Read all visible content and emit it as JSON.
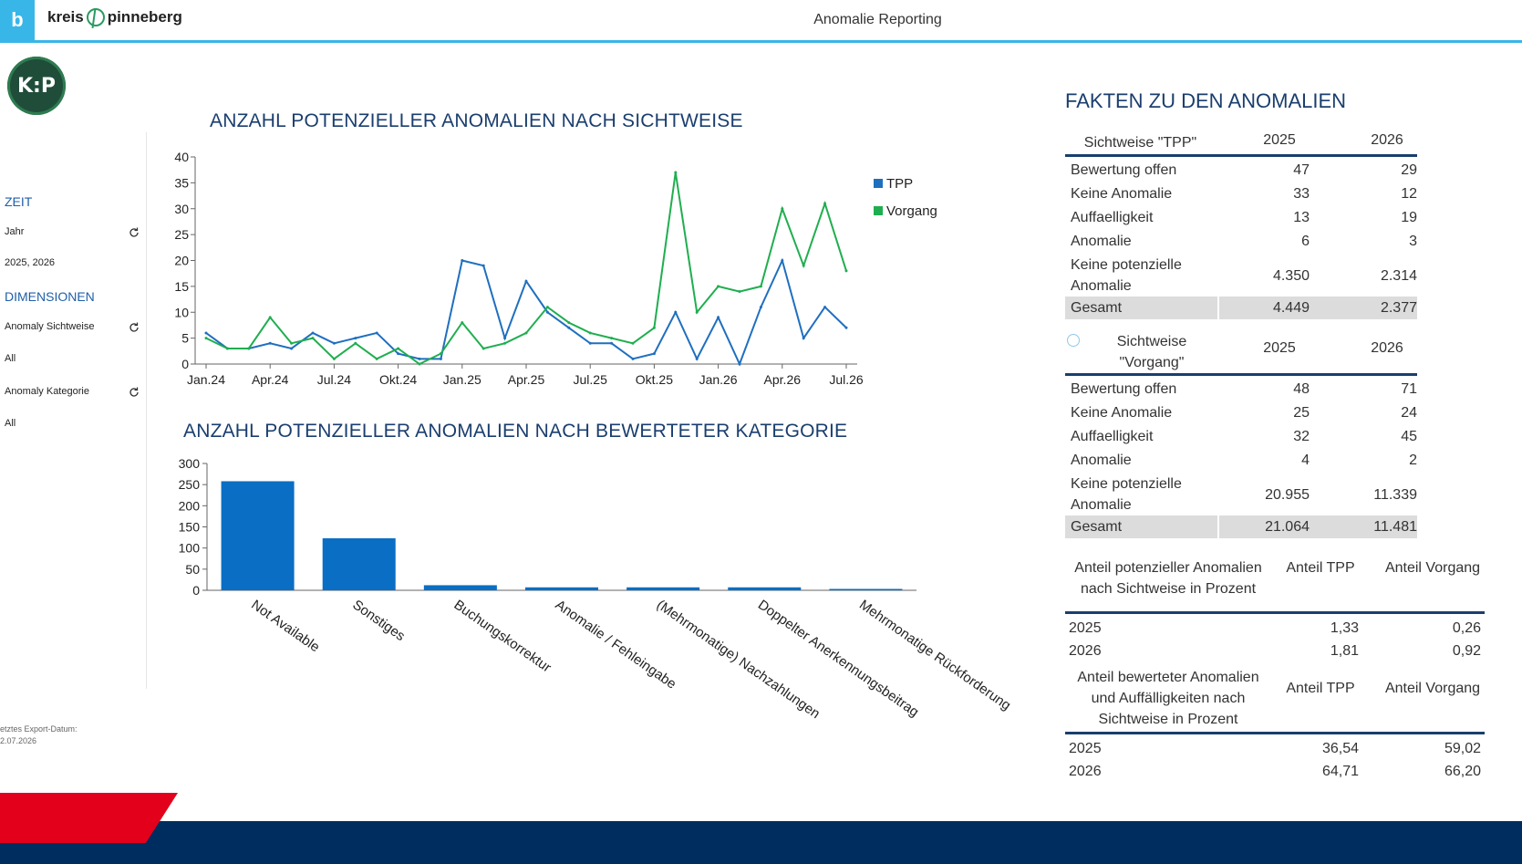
{
  "header": {
    "app_badge": "b",
    "brand_left": "kreis",
    "brand_right": "pinneberg",
    "title": "Anomalie Reporting"
  },
  "logo": {
    "text": "K:P"
  },
  "sidebar": {
    "zeit": "ZEIT",
    "jahr_label": "Jahr",
    "jahr_value": "2025, 2026",
    "dimensionen": "DIMENSIONEN",
    "sichtweise_label": "Anomaly Sichtweise",
    "sichtweise_value": "All",
    "kategorie_label": "Anomaly Kategorie",
    "kategorie_value": "All",
    "export_label": "etztes Export-Datum:",
    "export_value": "2.07.2026"
  },
  "line_chart": {
    "title": "ANZAHL POTENZIELLER ANOMALIEN NACH SICHTWEISE"
  },
  "bar_chart": {
    "title": "ANZAHL POTENZIELLER ANOMALIEN NACH BEWERTETER KATEGORIE"
  },
  "chart_data": [
    {
      "type": "line",
      "x": [
        "Jan.24",
        "Feb.24",
        "Mär.24",
        "Apr.24",
        "Mai.24",
        "Jun.24",
        "Jul.24",
        "Aug.24",
        "Sep.24",
        "Okt.24",
        "Nov.24",
        "Dez.24",
        "Jan.25",
        "Feb.25",
        "Mär.25",
        "Apr.25",
        "Mai.25",
        "Jun.25",
        "Jul.25",
        "Aug.25",
        "Sep.25",
        "Okt.25",
        "Nov.25",
        "Dez.25",
        "Jan.26",
        "Feb.26",
        "Mär.26",
        "Apr.26",
        "Mai.26",
        "Jun.26",
        "Jul.26"
      ],
      "xticks": [
        "Jan.24",
        "Apr.24",
        "Jul.24",
        "Okt.24",
        "Jan.25",
        "Apr.25",
        "Jul.25",
        "Okt.25",
        "Jan.26",
        "Apr.26",
        "Jul.26"
      ],
      "series": [
        {
          "name": "TPP",
          "color": "#1f6fbf",
          "values": [
            6,
            3,
            3,
            4,
            3,
            6,
            4,
            5,
            6,
            2,
            1,
            1,
            20,
            19,
            5,
            16,
            10,
            7,
            4,
            4,
            1,
            2,
            10,
            1,
            9,
            0,
            11,
            20,
            5,
            11,
            7
          ]
        },
        {
          "name": "Vorgang",
          "color": "#1fae4f",
          "values": [
            5,
            3,
            3,
            9,
            4,
            5,
            1,
            4,
            1,
            3,
            0,
            2,
            8,
            3,
            4,
            6,
            11,
            8,
            6,
            5,
            4,
            7,
            37,
            10,
            15,
            14,
            15,
            30,
            19,
            31,
            18
          ]
        }
      ],
      "ylim": [
        0,
        40
      ],
      "yticks": [
        0,
        5,
        10,
        15,
        20,
        25,
        30,
        35,
        40
      ]
    },
    {
      "type": "bar",
      "categories": [
        "Not Available",
        "Sonstiges",
        "Buchungskorrektur",
        "Anomalie / Fehleingabe",
        "(Mehrmonatige) Nachzahlungen",
        "Doppelter Anerkennungsbeitrag",
        "Mehrmonatige Rückforderung"
      ],
      "values": [
        258,
        123,
        12,
        7,
        7,
        7,
        3
      ],
      "color": "#0a6ec4",
      "ylim": [
        0,
        300
      ],
      "yticks": [
        0,
        50,
        100,
        150,
        200,
        250,
        300
      ]
    }
  ],
  "facts": {
    "title": "FAKTEN ZU DEN ANOMALIEN",
    "tpp": {
      "header": [
        "Sichtweise \"TPP\"",
        "2025",
        "2026"
      ],
      "rows": [
        [
          "Bewertung offen",
          "47",
          "29"
        ],
        [
          "Keine Anomalie",
          "33",
          "12"
        ],
        [
          "Auffaelligkeit",
          "13",
          "19"
        ],
        [
          "Anomalie",
          "6",
          "3"
        ],
        [
          "Keine potenzielle Anomalie",
          "4.350",
          "2.314"
        ]
      ],
      "total": [
        "Gesamt",
        "4.449",
        "2.377"
      ]
    },
    "vorgang": {
      "header": [
        "Sichtweise \"Vorgang\"",
        "2025",
        "2026"
      ],
      "rows": [
        [
          "Bewertung offen",
          "48",
          "71"
        ],
        [
          "Keine Anomalie",
          "25",
          "24"
        ],
        [
          "Auffaelligkeit",
          "32",
          "45"
        ],
        [
          "Anomalie",
          "4",
          "2"
        ],
        [
          "Keine potenzielle Anomalie",
          "20.955",
          "11.339"
        ]
      ],
      "total": [
        "Gesamt",
        "21.064",
        "11.481"
      ]
    },
    "anteil_pot": {
      "header": [
        "Anteil potenzieller Anomalien nach Sichtweise in Prozent",
        "Anteil TPP",
        "Anteil Vorgang"
      ],
      "rows": [
        [
          "2025",
          "1,33",
          "0,26"
        ],
        [
          "2026",
          "1,81",
          "0,92"
        ]
      ]
    },
    "anteil_bew": {
      "header": [
        "Anteil bewerteter Anomalien und Auffälligkeiten nach Sichtweise in Prozent",
        "Anteil TPP",
        "Anteil Vorgang"
      ],
      "rows": [
        [
          "2025",
          "36,54",
          "59,02"
        ],
        [
          "2026",
          "64,71",
          "66,20"
        ]
      ]
    }
  }
}
